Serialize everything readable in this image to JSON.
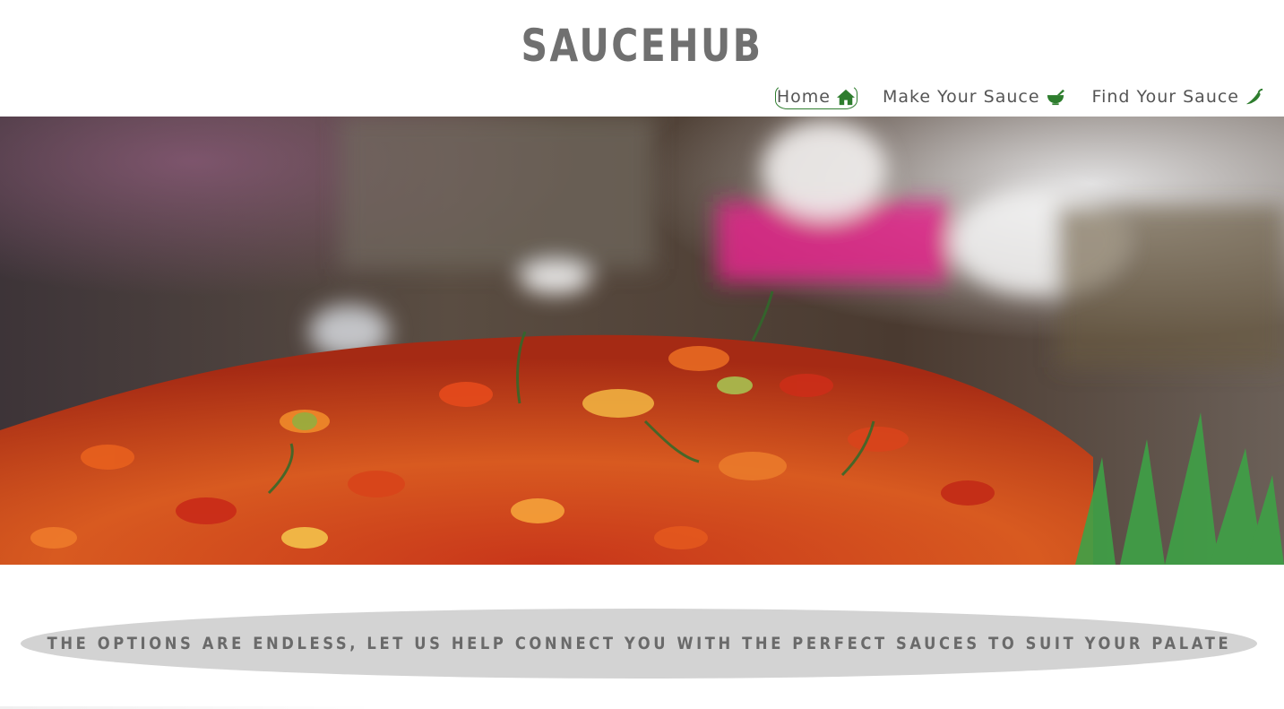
{
  "site": {
    "title": "SAUCEHUB"
  },
  "nav": {
    "items": [
      {
        "label": "Home",
        "icon": "home-icon",
        "active": true
      },
      {
        "label": "Make Your Sauce",
        "icon": "mortar-pestle-icon",
        "active": false
      },
      {
        "label": "Find Your Sauce",
        "icon": "pepper-icon",
        "active": false
      }
    ]
  },
  "hero": {
    "image": "chili-peppers-hero-image"
  },
  "banner": {
    "text": "THE OPTIONS ARE ENDLESS, LET US HELP CONNECT YOU WITH THE PERFECT SAUCES TO SUIT YOUR PALATE"
  },
  "colors": {
    "accent": "#2e7d2e",
    "text": "#555555",
    "banner_bg": "#d3d3d3"
  }
}
